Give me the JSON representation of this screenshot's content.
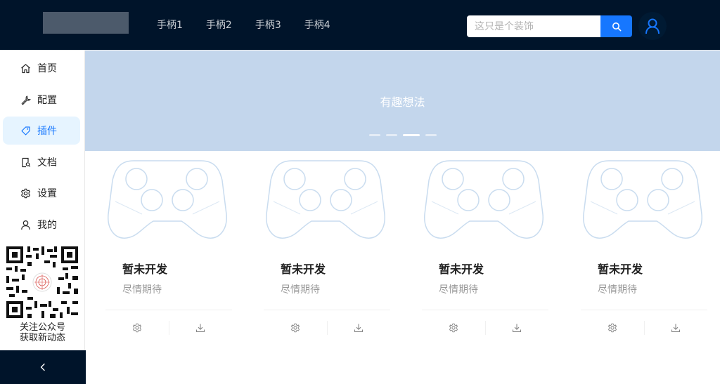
{
  "header": {
    "nav": [
      "手柄1",
      "手柄2",
      "手柄3",
      "手柄4"
    ],
    "search": {
      "placeholder": "这只是个装饰",
      "value": ""
    },
    "search_icon": "search-icon",
    "avatar_icon": "user-icon"
  },
  "sidebar": {
    "items": [
      {
        "label": "首页",
        "icon": "home-icon"
      },
      {
        "label": "配置",
        "icon": "wrench-icon"
      },
      {
        "label": "插件",
        "icon": "tag-icon",
        "active": true
      },
      {
        "label": "文档",
        "icon": "document-search-icon"
      },
      {
        "label": "设置",
        "icon": "gear-icon"
      },
      {
        "label": "我的",
        "icon": "user-icon"
      }
    ],
    "qr_caption_line1": "关注公众号",
    "qr_caption_line2": "获取新动态",
    "collapse_icon": "chevron-left-icon"
  },
  "banner": {
    "title": "有趣想法",
    "slides": 4,
    "active_slide": 3,
    "color": "#c3d6ec"
  },
  "cards": [
    {
      "title": "暂未开发",
      "desc": "尽情期待",
      "cover_icon": "gamepad-icon"
    },
    {
      "title": "暂未开发",
      "desc": "尽情期待",
      "cover_icon": "gamepad-icon"
    },
    {
      "title": "暂未开发",
      "desc": "尽情期待",
      "cover_icon": "gamepad-icon"
    },
    {
      "title": "暂未开发",
      "desc": "尽情期待",
      "cover_icon": "gamepad-icon"
    }
  ],
  "colors": {
    "header_bg": "#00142a",
    "accent": "#1677ff",
    "active_bg": "#e6f4ff"
  }
}
